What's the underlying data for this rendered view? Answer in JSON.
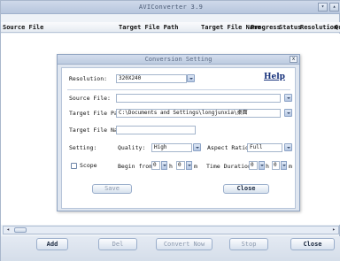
{
  "window": {
    "title": "AVIConverter 3.9",
    "minimize": "▾",
    "restore": "▴"
  },
  "columns": [
    "Source File",
    "Target File Path",
    "Target File Name",
    "Progress",
    "Status",
    "Resolution",
    "Qu"
  ],
  "toolbar": {
    "add": "Add",
    "del": "Del",
    "convert": "Convert Now",
    "stop": "Stop",
    "close": "Close"
  },
  "scroll": {
    "left": "◂",
    "right": "▸"
  },
  "dialog": {
    "title": "Conversion Setting",
    "close_glyph": "x",
    "resolution_label": "Resolution:",
    "resolution_value": "320X240",
    "help": "Help",
    "source_label": "Source File:",
    "source_value": "",
    "target_path_label": "Target File Path:",
    "target_path_value": "C:\\Documents and Settings\\longjunxia\\桌面",
    "target_name_label": "Target File Name:",
    "target_name_value": "",
    "setting_label": "Setting:",
    "quality_label": "Quality:",
    "quality_value": "High",
    "aspect_label": "Aspect Ratio:",
    "aspect_value": "Full",
    "scope_label": "Scope",
    "begin_label": "Begin from:",
    "begin_h": "0",
    "h_unit": "h",
    "begin_m": "0",
    "m_unit": "m",
    "duration_label": "Time Duration:",
    "dur_h": "0",
    "dur_m": "0",
    "save": "Save",
    "close": "Close"
  }
}
